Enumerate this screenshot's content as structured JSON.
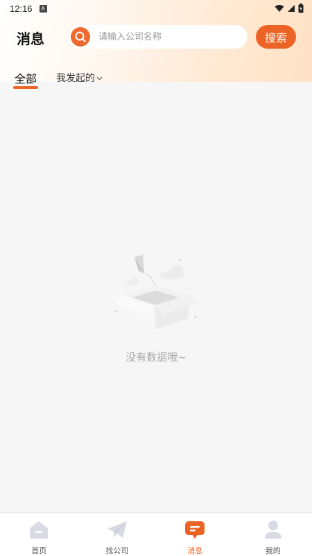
{
  "status_bar": {
    "time": "12:16",
    "notification_icon": "A"
  },
  "header": {
    "title": "消息",
    "search_placeholder": "请输入公司名称",
    "search_button": "搜索"
  },
  "tabs": {
    "all_label": "全部",
    "mine_label": "我发起的"
  },
  "empty_state": {
    "message": "没有数据哦~"
  },
  "bottom_nav": [
    {
      "label": "首页",
      "icon": "home-icon",
      "active": false
    },
    {
      "label": "找公司",
      "icon": "paper-plane-icon",
      "active": false
    },
    {
      "label": "消息",
      "icon": "message-icon",
      "active": true
    },
    {
      "label": "我的",
      "icon": "person-icon",
      "active": false
    }
  ],
  "colors": {
    "accent": "#ec6425",
    "inactive_icon": "#d8dbe3",
    "empty_text": "#a8a8a8"
  }
}
